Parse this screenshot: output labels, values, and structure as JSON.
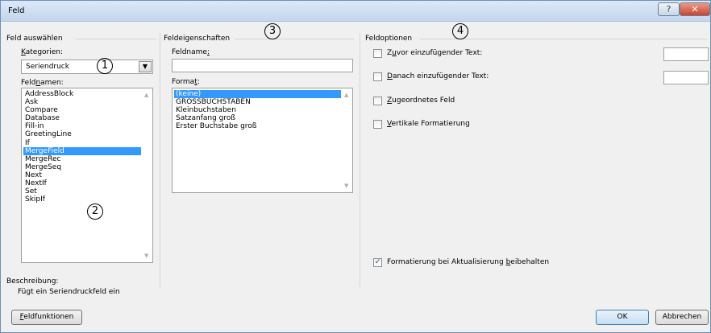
{
  "window": {
    "title": "Feld",
    "help_glyph": "?",
    "close_glyph": "✕"
  },
  "field_select": {
    "group_title": "Feld auswählen",
    "category_label": "Kategorien:",
    "category_value": "Seriendruck",
    "fieldnames_label": "Feldnamen:",
    "fieldnames": [
      "AddressBlock",
      "Ask",
      "Compare",
      "Database",
      "Fill-in",
      "GreetingLine",
      "If",
      "MergeField",
      "MergeRec",
      "MergeSeq",
      "Next",
      "NextIf",
      "Set",
      "SkipIf"
    ],
    "selected_index": 7
  },
  "field_props": {
    "group_title": "Feldeigenschaften",
    "fieldname_label": "Feldname:",
    "fieldname_value": "",
    "format_label": "Format:",
    "formats": [
      "(keine)",
      "GROSSBUCHSTABEN",
      "Kleinbuchstaben",
      "Satzanfang groß",
      "Erster Buchstabe groß"
    ],
    "selected_index": 0
  },
  "field_options": {
    "group_title": "Feldoptionen",
    "before_text": {
      "label": "Zuvor einzufügender Text:",
      "checked": false,
      "value": ""
    },
    "after_text": {
      "label": "Danach einzufügender Text:",
      "checked": false,
      "value": ""
    },
    "mapped_field": {
      "label": "Zugeordnetes Feld",
      "checked": false
    },
    "vertical_format": {
      "label": "Vertikale Formatierung",
      "checked": false
    },
    "keep_formatting": {
      "label": "Formatierung bei Aktualisierung beibehalten",
      "checked": true
    }
  },
  "description": {
    "label": "Beschreibung:",
    "text": "Fügt ein Seriendruckfeld ein"
  },
  "buttons": {
    "field_codes": "Feldfunktionen",
    "ok": "OK",
    "cancel": "Abbrechen"
  },
  "callouts": [
    "1",
    "2",
    "3",
    "4"
  ]
}
